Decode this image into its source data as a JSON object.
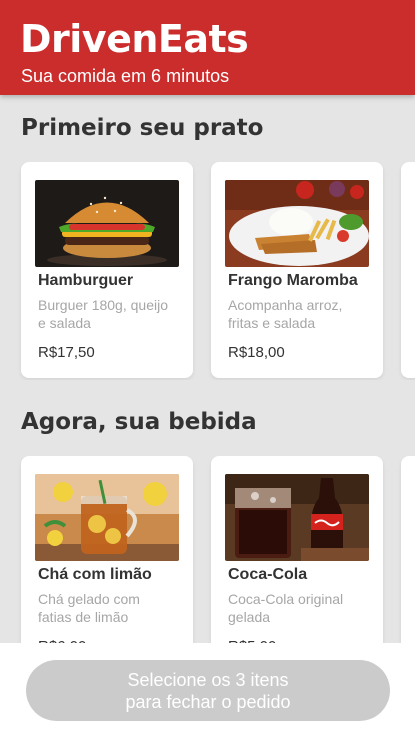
{
  "header": {
    "brand": "DrivenEats",
    "tagline": "Sua comida em 6 minutos"
  },
  "sections": [
    {
      "title": "Primeiro seu prato",
      "items": [
        {
          "name": "Hamburguer",
          "desc_line1": "Burguer 180g, queijo",
          "desc_line2": "e salada",
          "price": "R$17,50",
          "image": "hamburger-photo"
        },
        {
          "name": "Frango Maromba",
          "desc_line1": "Acompanha arroz,",
          "desc_line2": "fritas e salada",
          "price": "R$18,00",
          "image": "chicken-plate-photo"
        }
      ]
    },
    {
      "title": "Agora, sua bebida",
      "items": [
        {
          "name": "Chá com limão",
          "desc_line1": "Chá gelado com",
          "desc_line2": "fatias de limão",
          "price": "R$6,00",
          "image": "iced-tea-photo"
        },
        {
          "name": "Coca-Cola",
          "desc_line1": "Coca-Cola original",
          "desc_line2": "gelada",
          "price": "R$5,00",
          "image": "coca-cola-photo"
        }
      ]
    }
  ],
  "footer": {
    "button_line1": "Selecione os 3 itens",
    "button_line2": "para fechar o pedido"
  },
  "colors": {
    "brand_red": "#cb2c2c",
    "background": "#e5e5e5",
    "button_disabled": "#cbcbcb"
  }
}
